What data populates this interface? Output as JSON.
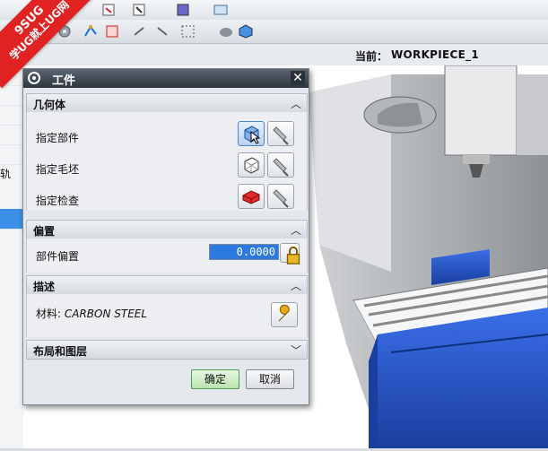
{
  "watermark": {
    "line1": "9SUG",
    "line2": "学UG就上UG网"
  },
  "infobar": {
    "label": "当前：",
    "value": "WORKPIECE_1"
  },
  "navigator": {
    "visible_text": "轨"
  },
  "dialog": {
    "title": "工件",
    "sections": {
      "geometry": {
        "title": "几何体",
        "rows": [
          {
            "label": "指定部件",
            "icon": "part-cube-icon"
          },
          {
            "label": "指定毛坯",
            "icon": "blank-wireframe-icon"
          },
          {
            "label": "指定检查",
            "icon": "check-red-block-icon"
          }
        ]
      },
      "offset": {
        "title": "偏置",
        "label": "部件偏置",
        "value": "0.0000"
      },
      "description": {
        "title": "描述",
        "material_prefix": "材料:",
        "material_value": "CARBON STEEL"
      },
      "layout": {
        "title": "布局和图层"
      }
    },
    "buttons": {
      "ok": "确定",
      "cancel": "取消"
    }
  },
  "colors": {
    "title_bar": "#2d353d",
    "input_highlight": "#2c79e0",
    "machine_blue": "#1f4fc6",
    "watermark_red": "#e02222"
  }
}
